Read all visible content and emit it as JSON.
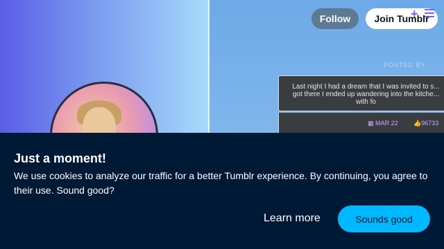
{
  "header": {
    "follow_label": "Follow",
    "join_label": "Join Tumblr"
  },
  "post": {
    "posted_by": "POSTED BY",
    "text": "Last night I had a dream that I was invited to s... got there I ended up wandering into the kitche... with fo",
    "date": "MAR 22",
    "likes": "96733"
  },
  "cookie": {
    "title": "Just a moment!",
    "message": "We use cookies to analyze our traffic for a better Tumblr experience. By continuing, you agree to their use. Sound good?",
    "learn_more": "Learn more",
    "accept": "Sounds good"
  },
  "colors": {
    "banner_bg": "#001935",
    "accept_button": "#00b8ff",
    "follow_button": "#5e7993",
    "accent": "#7b5cff"
  },
  "icons": [
    "plus-icon",
    "menu-icon",
    "calendar-icon",
    "thumbs-up-icon"
  ]
}
